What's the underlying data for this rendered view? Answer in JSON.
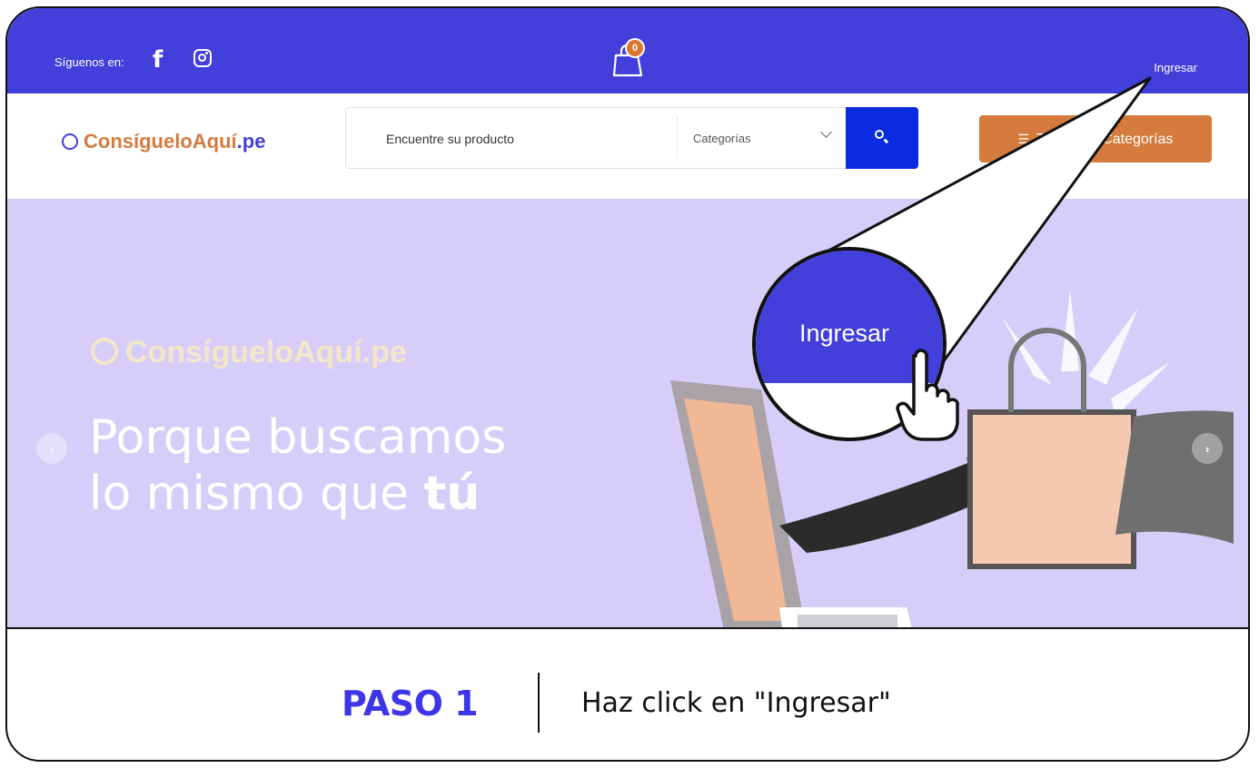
{
  "topbar": {
    "follow_label": "Síguenos en:",
    "facebook_icon": "facebook-icon",
    "instagram_icon": "instagram-icon",
    "cart_count": "0",
    "login_label": "Ingresar",
    "background_color": "#423fdb"
  },
  "header": {
    "logo_text": "ConsígueloAquí",
    "logo_domain": ".pe",
    "search_placeholder": "Encuentre su producto",
    "category_select": "Categorías",
    "all_categories_button": "Todas las Categorías",
    "accent_color": "#d47b3d",
    "search_button_color": "#0a2be0"
  },
  "hero": {
    "logo_text": "ConsígueloAquí.pe",
    "tagline_line1": "Porque buscamos",
    "tagline_line2_prefix": "lo mismo que ",
    "tagline_line2_bold": "tú",
    "background_color": "#d6cef8"
  },
  "callout": {
    "magnified_label": "Ingresar"
  },
  "step": {
    "number_label": "PASO 1",
    "instruction": "Haz click en \"Ingresar\"",
    "color": "#3d36e8"
  }
}
